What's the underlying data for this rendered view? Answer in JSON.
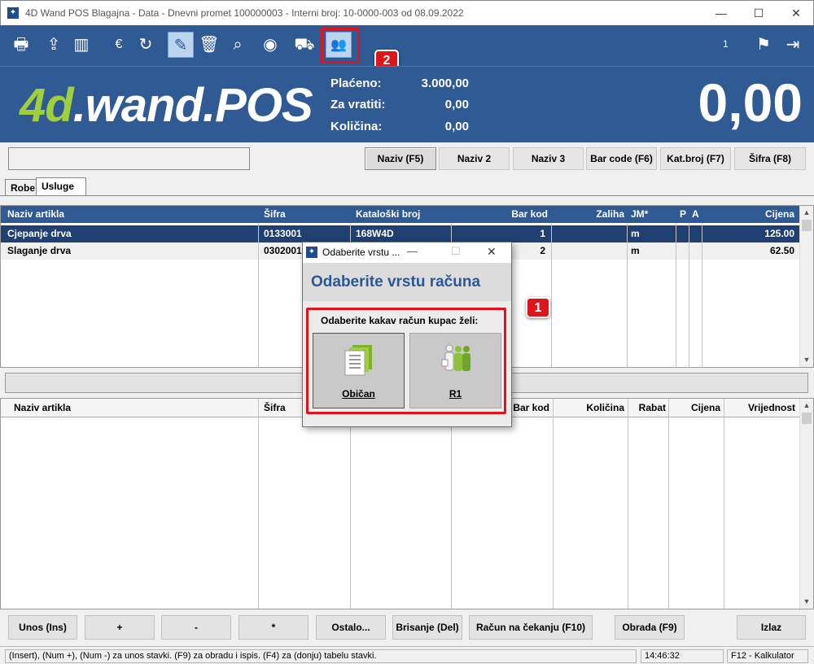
{
  "window": {
    "title": "4D Wand POS Blagajna - Data - Dnevni promet 100000003 - Interni broj: 10-0000-003 od 08.09.2022",
    "app_icon": "compass-star-icon",
    "minimize": "—",
    "maximize": "☐",
    "close": "✕"
  },
  "toolbar": {
    "items": [
      {
        "name": "printer-icon",
        "glyph": "🖶"
      },
      {
        "name": "upload-tray-icon",
        "glyph": "⇪"
      },
      {
        "name": "barcode-icon",
        "glyph": "▥"
      },
      {
        "name": "euro-icon",
        "glyph": "€"
      },
      {
        "name": "refresh-icon",
        "glyph": "↻"
      },
      {
        "name": "calculator-pen-icon",
        "glyph": "✎"
      },
      {
        "name": "trash-icon",
        "glyph": "🗑"
      },
      {
        "name": "search-icon",
        "glyph": "⌕"
      },
      {
        "name": "record-icon",
        "glyph": "◉"
      },
      {
        "name": "hand-truck-icon",
        "glyph": "⛟"
      },
      {
        "name": "people-icon",
        "glyph": "👥"
      }
    ],
    "counter": "1",
    "signpost_icon": "⚑",
    "exit_icon": "⇥"
  },
  "callouts": {
    "dialog_badge": "1",
    "toolbar_badge": "2"
  },
  "banner": {
    "logo_prefix": "4d",
    "logo_middle": ".wand.",
    "logo_suffix": "POS",
    "stats": [
      {
        "label": "Plaćeno:",
        "value": "3.000,00"
      },
      {
        "label": "Za vratiti:",
        "value": "0,00"
      },
      {
        "label": "Količina:",
        "value": "0,00"
      }
    ],
    "total": "0,00"
  },
  "search": {
    "value": "",
    "buttons": [
      "Naziv (F5)",
      "Naziv 2",
      "Naziv 3",
      "Bar code (F6)",
      "Kat.broj (F7)",
      "Šifra (F8)"
    ]
  },
  "tabs": [
    "Robe",
    "Usluge"
  ],
  "articles": {
    "columns": [
      "Naziv artikla",
      "Šifra",
      "Kataloški broj",
      "Bar kod",
      "Zaliha",
      "JM*",
      "P",
      "A",
      "Cijena"
    ],
    "rows": [
      [
        "Cjepanje drva",
        "0133001",
        "168W4D",
        "1",
        "",
        "m",
        "",
        "",
        "125.00"
      ],
      [
        "Slaganje drva",
        "0302001",
        "",
        "2",
        "",
        "m",
        "",
        "",
        "62.50"
      ]
    ]
  },
  "items": {
    "columns": [
      "Naziv artikla",
      "Šifra",
      "",
      "Bar kod",
      "Količina",
      "Rabat",
      "Cijena",
      "Vrijednost"
    ]
  },
  "bottom_buttons": [
    "Unos (Ins)",
    "+",
    "-",
    "*",
    "Ostalo...",
    "Brisanje (Del)",
    "Račun na čekanju (F10)",
    "Obrada (F9)",
    "Izlaz"
  ],
  "status": {
    "hint": "(Insert), (Num +), (Num -) za unos stavki. (F9) za obradu i ispis. (F4) za (donju) tabelu stavki.",
    "time": "14:46:32",
    "key": "F12 - Kalkulator"
  },
  "dialog": {
    "title": "Odaberite vrstu ...",
    "heading": "Odaberite vrstu računa",
    "prompt": "Odaberite kakav račun kupac želi:",
    "options": [
      {
        "label": "Običan",
        "icon": "document-stack-icon"
      },
      {
        "label": "R1",
        "icon": "business-people-icon"
      }
    ]
  },
  "colors": {
    "brand_blue": "#2f5a94",
    "accent_green": "#9fcf3c",
    "callout_red": "#e0141b"
  }
}
